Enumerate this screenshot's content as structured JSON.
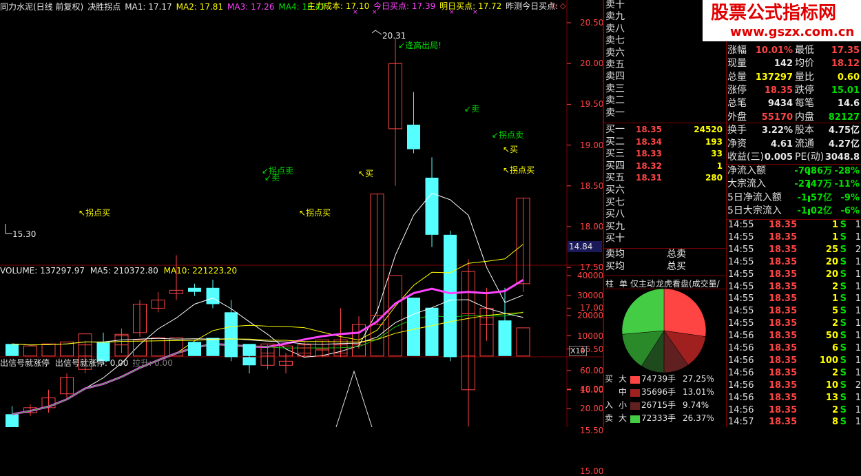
{
  "top_bar": {
    "title": "同力水泥(日线 前复权)",
    "indicator": "决胜拐点",
    "ma1": "MA1: 17.17",
    "ma2": "MA2: 17.81",
    "ma3": "MA3: 17.26",
    "ma4": "MA4: 16.47",
    "main_cost": "主力成本: 17.10",
    "today_buy": "今日买点: 17.39",
    "tomorrow_buy": "明日买点: 17.72",
    "yest_forecast": "昨测今日买点:"
  },
  "price_axis": [
    "20.50",
    "20.00",
    "19.50",
    "19.00",
    "18.50",
    "18.00",
    "17.50",
    "17.00",
    "16.50",
    "16.00",
    "15.50",
    "15.00"
  ],
  "price_marker": "14.84",
  "annotations": {
    "high": "20.31",
    "low": "15.30",
    "high_note": "逢高出局!",
    "sell1": "卖",
    "turn_sell1": "拐点卖",
    "turn_sell2": "拐点卖",
    "turn_sell3": "卖",
    "buy1": "买",
    "buy2": "买",
    "turn_buy1": "拐点买",
    "turn_buy2": "拐点买",
    "turn_buy3": "拐点买"
  },
  "volume_bar": {
    "volume": "VOLUME: 137297.97",
    "ma5": "MA5: 210372.80",
    "ma10": "MA10: 221223.20"
  },
  "vol_axis": [
    "40000",
    "30000",
    "20000",
    "10000"
  ],
  "vol_unit": "X10",
  "signal_bar": {
    "label": "出信号就涨停",
    "label2": "出信号就涨停: 0.00",
    "label3": "拉升: 0.00"
  },
  "sig_axis": [
    "60.00",
    "40.00",
    "20.00"
  ],
  "chart_data": {
    "type": "candlestick",
    "candles": [
      {
        "o": 15.52,
        "c": 15.7,
        "h": 15.8,
        "l": 15.3,
        "up": false
      },
      {
        "o": 15.72,
        "c": 15.78,
        "h": 15.82,
        "l": 15.68,
        "up": true
      },
      {
        "o": 15.78,
        "c": 15.9,
        "h": 16.0,
        "l": 15.72,
        "up": true
      },
      {
        "o": 15.95,
        "c": 16.15,
        "h": 16.2,
        "l": 15.9,
        "up": true
      },
      {
        "o": 16.25,
        "c": 16.55,
        "h": 16.6,
        "l": 16.2,
        "up": true
      },
      {
        "o": 16.58,
        "c": 16.35,
        "h": 16.7,
        "l": 16.3,
        "up": false
      },
      {
        "o": 16.55,
        "c": 16.68,
        "h": 16.75,
        "l": 16.45,
        "up": true
      },
      {
        "o": 16.7,
        "c": 17.05,
        "h": 17.1,
        "l": 16.65,
        "up": true
      },
      {
        "o": 17.0,
        "c": 17.1,
        "h": 17.2,
        "l": 16.95,
        "up": true
      },
      {
        "o": 17.18,
        "c": 17.22,
        "h": 17.65,
        "l": 17.1,
        "up": true
      },
      {
        "o": 17.25,
        "c": 17.2,
        "h": 17.3,
        "l": 17.15,
        "up": false
      },
      {
        "o": 17.25,
        "c": 17.05,
        "h": 17.35,
        "l": 17.0,
        "up": false
      },
      {
        "o": 16.95,
        "c": 16.4,
        "h": 17.1,
        "l": 16.35,
        "up": false
      },
      {
        "o": 16.4,
        "c": 16.3,
        "h": 16.45,
        "l": 16.2,
        "up": false
      },
      {
        "o": 16.3,
        "c": 16.45,
        "h": 16.55,
        "l": 16.25,
        "up": true
      },
      {
        "o": 16.35,
        "c": 16.3,
        "h": 16.45,
        "l": 16.2,
        "up": true
      },
      {
        "o": 16.45,
        "c": 16.55,
        "h": 16.6,
        "l": 16.4,
        "up": true
      },
      {
        "o": 16.5,
        "c": 16.5,
        "h": 16.6,
        "l": 16.4,
        "up": true
      },
      {
        "o": 16.45,
        "c": 16.55,
        "h": 17.0,
        "l": 16.4,
        "up": true
      },
      {
        "o": 16.55,
        "c": 16.8,
        "h": 16.9,
        "l": 16.5,
        "up": true
      },
      {
        "o": 16.8,
        "c": 18.4,
        "h": 18.4,
        "l": 16.8,
        "up": true
      },
      {
        "o": 19.2,
        "c": 20.0,
        "h": 20.31,
        "l": 18.5,
        "up": true
      },
      {
        "o": 19.25,
        "c": 18.95,
        "h": 19.65,
        "l": 18.9,
        "up": false
      },
      {
        "o": 18.6,
        "c": 17.9,
        "h": 18.85,
        "l": 17.75,
        "up": false
      },
      {
        "o": 17.9,
        "c": 16.4,
        "h": 17.95,
        "l": 16.35,
        "up": false
      },
      {
        "o": 16.0,
        "c": 17.45,
        "h": 17.6,
        "l": 15.55,
        "up": true
      },
      {
        "o": 17.0,
        "c": 16.8,
        "h": 17.25,
        "l": 16.6,
        "up": true
      },
      {
        "o": 16.85,
        "c": 16.8,
        "h": 17.25,
        "l": 16.45,
        "up": false
      },
      {
        "o": 17.3,
        "c": 18.35,
        "h": 18.35,
        "l": 17.2,
        "up": true
      }
    ],
    "volume": [
      6,
      5,
      6,
      7,
      11,
      6,
      10,
      8,
      9,
      9,
      7,
      9,
      9,
      6,
      6,
      5,
      4,
      8,
      8,
      7,
      20,
      40,
      29,
      24,
      26,
      21,
      19,
      16,
      14
    ],
    "volume_up": [
      false,
      true,
      true,
      true,
      true,
      false,
      true,
      true,
      true,
      true,
      false,
      false,
      false,
      false,
      true,
      true,
      true,
      true,
      true,
      true,
      true,
      true,
      false,
      false,
      false,
      true,
      true,
      false,
      true
    ],
    "ma_lines": [
      "MA1",
      "MA2",
      "MA3",
      "MA4"
    ]
  },
  "orderbook": {
    "sells": [
      {
        "label": "卖十"
      },
      {
        "label": "卖九"
      },
      {
        "label": "卖八"
      },
      {
        "label": "卖七"
      },
      {
        "label": "卖六"
      },
      {
        "label": "卖五"
      },
      {
        "label": "卖四"
      },
      {
        "label": "卖三"
      },
      {
        "label": "卖二"
      },
      {
        "label": "卖一"
      }
    ],
    "buys": [
      {
        "label": "买一",
        "price": "18.35",
        "vol": "24520"
      },
      {
        "label": "买二",
        "price": "18.34",
        "vol": "193"
      },
      {
        "label": "买三",
        "price": "18.33",
        "vol": "33"
      },
      {
        "label": "买四",
        "price": "18.32",
        "vol": "1"
      },
      {
        "label": "买五",
        "price": "18.31",
        "vol": "280"
      },
      {
        "label": "买六",
        "price": "",
        "vol": ""
      },
      {
        "label": "买七",
        "price": "",
        "vol": ""
      },
      {
        "label": "买八",
        "price": "",
        "vol": ""
      },
      {
        "label": "买九",
        "price": "",
        "vol": ""
      },
      {
        "label": "买十",
        "price": "",
        "vol": ""
      }
    ],
    "sell_avg": "卖均",
    "sell_total": "总卖",
    "buy_avg": "买均",
    "buy_total": "总买"
  },
  "tabs": [
    "柱",
    "单",
    "仅主动",
    "龙虎看盘(成交量/涉"
  ],
  "pie": {
    "slices": [
      {
        "name": "买大",
        "pct": 27.25,
        "color": "#ff4444"
      },
      {
        "name": "买中",
        "pct": 13.01,
        "color": "#a02020"
      },
      {
        "name": "买小",
        "pct": 9.74,
        "color": "#602020"
      },
      {
        "name": "卖小",
        "pct": 9.0,
        "color": "#1e4a1e"
      },
      {
        "name": "卖中",
        "pct": 14.6,
        "color": "#2a8a2a"
      },
      {
        "name": "卖大",
        "pct": 26.37,
        "color": "#44cc44"
      }
    ]
  },
  "flows": [
    {
      "side": "买",
      "size": "大",
      "vol": "74739手",
      "pct": "27.25%",
      "color": "#ff4444"
    },
    {
      "side": "",
      "size": "中",
      "vol": "35696手",
      "pct": "13.01%",
      "color": "#a02020"
    },
    {
      "side": "入",
      "size": "小",
      "vol": "26715手",
      "pct": "9.74%",
      "color": "#602020"
    },
    {
      "side": "卖",
      "size": "大",
      "vol": "72333手",
      "pct": "26.37%",
      "color": "#44cc44"
    }
  ],
  "stats": [
    {
      "k": "涨幅",
      "v": "10.01%",
      "vc": "#ff4444",
      "k2": "最低",
      "v2": "17.35",
      "v2c": "#ff4444"
    },
    {
      "k": "现量",
      "v": "142",
      "vc": "#e8e8e8",
      "k2": "均价",
      "v2": "18.12",
      "v2c": "#ff4444"
    },
    {
      "k": "总量",
      "v": "137297",
      "vc": "#ffff00",
      "k2": "量比",
      "v2": "0.60",
      "v2c": "#ffff00"
    },
    {
      "k": "涨停",
      "v": "18.35",
      "vc": "#ff4444",
      "k2": "跌停",
      "v2": "15.01",
      "v2c": "#00dd00"
    },
    {
      "k": "总笔",
      "v": "9434",
      "vc": "#e8e8e8",
      "k2": "每笔",
      "v2": "14.6",
      "v2c": "#e8e8e8"
    },
    {
      "k": "外盘",
      "v": "55170",
      "vc": "#ff4444",
      "k2": "内盘",
      "v2": "82127",
      "v2c": "#00dd00"
    }
  ],
  "stats2": [
    {
      "k": "换手",
      "v": "3.22%",
      "vc": "#e8e8e8",
      "k2": "股本",
      "v2": "4.75亿",
      "v2c": "#e8e8e8"
    },
    {
      "k": "净资",
      "v": "4.61",
      "vc": "#e8e8e8",
      "k2": "流通",
      "v2": "4.27亿",
      "v2c": "#e8e8e8"
    },
    {
      "k": "收益(三)",
      "v": "0.005",
      "vc": "#e8e8e8",
      "k2": "PE(动)",
      "v2": "3048.8",
      "v2c": "#e8e8e8"
    }
  ],
  "netflow": [
    {
      "k": "净流入额",
      "v": "-7086万",
      "p": "-28%"
    },
    {
      "k": "大宗流入",
      "v": "-2747万",
      "p": "-11%"
    },
    {
      "k": "5日净流入额",
      "v": "-1.57亿",
      "p": "-9%"
    },
    {
      "k": "5日大宗流入",
      "v": "-1.02亿",
      "p": "-6%"
    }
  ],
  "ticks": [
    {
      "t": "14:55",
      "p": "18.35",
      "v": "1",
      "s": "S",
      "x": "1"
    },
    {
      "t": "14:55",
      "p": "18.35",
      "v": "1",
      "s": "S",
      "x": "1"
    },
    {
      "t": "14:55",
      "p": "18.35",
      "v": "25",
      "s": "S",
      "x": "2"
    },
    {
      "t": "14:55",
      "p": "18.35",
      "v": "20",
      "s": "S",
      "x": "1"
    },
    {
      "t": "14:55",
      "p": "18.35",
      "v": "20",
      "s": "S",
      "x": "1"
    },
    {
      "t": "14:55",
      "p": "18.35",
      "v": "2",
      "s": "S",
      "x": "1"
    },
    {
      "t": "14:55",
      "p": "18.35",
      "v": "1",
      "s": "S",
      "x": "1"
    },
    {
      "t": "14:55",
      "p": "18.35",
      "v": "5",
      "s": "S",
      "x": "1"
    },
    {
      "t": "14:55",
      "p": "18.35",
      "v": "2",
      "s": "S",
      "x": "1"
    },
    {
      "t": "14:56",
      "p": "18.35",
      "v": "50",
      "s": "S",
      "x": "1"
    },
    {
      "t": "14:56",
      "p": "18.35",
      "v": "6",
      "s": "S",
      "x": "1"
    },
    {
      "t": "14:56",
      "p": "18.35",
      "v": "100",
      "s": "S",
      "x": "1"
    },
    {
      "t": "14:56",
      "p": "18.35",
      "v": "2",
      "s": "S",
      "x": "1"
    },
    {
      "t": "14:56",
      "p": "18.35",
      "v": "10",
      "s": "S",
      "x": "2"
    },
    {
      "t": "14:56",
      "p": "18.35",
      "v": "13",
      "s": "S",
      "x": "1"
    },
    {
      "t": "14:56",
      "p": "18.35",
      "v": "2",
      "s": "S",
      "x": "1"
    },
    {
      "t": "14:57",
      "p": "18.35",
      "v": "8",
      "s": "S",
      "x": "1"
    }
  ],
  "logo": {
    "line1": "股票公式指标网",
    "line2": "www.gszx.com.cn"
  }
}
